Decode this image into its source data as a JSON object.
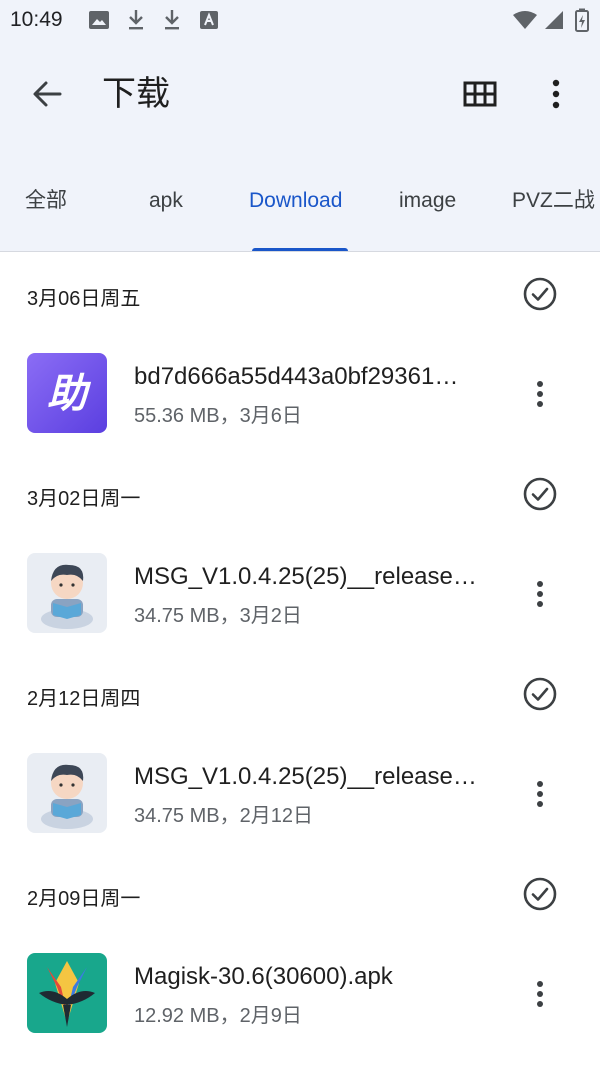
{
  "status_bar": {
    "time": "10:49",
    "left_icons": [
      "image-icon",
      "download-icon",
      "download-icon",
      "font-icon"
    ],
    "right_icons": [
      "wifi-icon",
      "signal-icon",
      "battery-icon"
    ]
  },
  "toolbar": {
    "title": "下载",
    "back_icon": "arrow-left-icon",
    "grid_icon": "grid-view-icon",
    "more_icon": "more-vert-icon"
  },
  "tabs": [
    {
      "label": "全部",
      "active": false
    },
    {
      "label": "apk",
      "active": false
    },
    {
      "label": "Download",
      "active": true
    },
    {
      "label": "image",
      "active": false
    },
    {
      "label": "PVZ二战",
      "active": false
    }
  ],
  "colors": {
    "accent": "#1a56c9",
    "header_bg": "#f0f3fa"
  },
  "groups": [
    {
      "date": "3月06日周五",
      "file": {
        "name": "bd7d666a55d443a0bf29361…",
        "meta": "55.36 MB，3月6日",
        "thumb": "assistant-app-icon",
        "thumb_text": "助"
      }
    },
    {
      "date": "3月02日周一",
      "file": {
        "name": "MSG_V1.0.4.25(25)__release…",
        "meta": "34.75 MB，3月2日",
        "thumb": "reading-boy-icon"
      }
    },
    {
      "date": "2月12日周四",
      "file": {
        "name": "MSG_V1.0.4.25(25)__release…",
        "meta": "34.75 MB，2月12日",
        "thumb": "reading-boy-icon"
      }
    },
    {
      "date": "2月09日周一",
      "file": {
        "name": "Magisk-30.6(30600).apk",
        "meta": "12.92 MB，2月9日",
        "thumb": "magisk-icon"
      }
    }
  ]
}
